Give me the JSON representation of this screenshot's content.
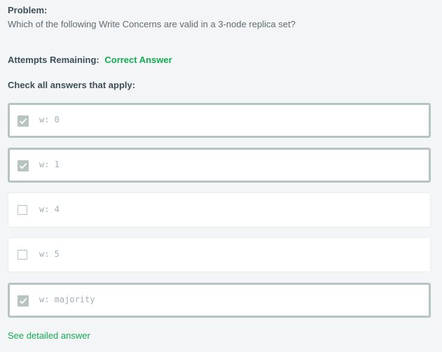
{
  "problem": {
    "label": "Problem:",
    "question": "Which of the following Write Concerns are valid in a 3-node replica set?"
  },
  "attempts": {
    "label": "Attempts Remaining:",
    "status": "Correct Answer",
    "status_color": "#13aa52"
  },
  "instructions": "Check all answers that apply:",
  "options": [
    {
      "label": "w: 0",
      "checked": true
    },
    {
      "label": "w: 1",
      "checked": true
    },
    {
      "label": "w: 4",
      "checked": false
    },
    {
      "label": "w: 5",
      "checked": false
    },
    {
      "label": "w: majority",
      "checked": true
    }
  ],
  "footer": {
    "detail_link": "See detailed answer"
  },
  "colors": {
    "accent_green": "#13aa52",
    "checkbox_gray": "#b8c4c2",
    "background": "#f4f5f6"
  }
}
